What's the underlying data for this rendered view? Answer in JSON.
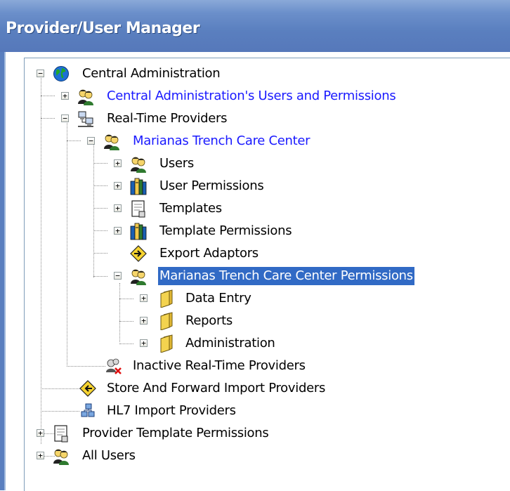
{
  "window": {
    "title": "Provider/User Manager"
  },
  "tree": {
    "root": {
      "label": "Central Administration"
    },
    "nodes": [
      {
        "label": "Central Administration's Users and Permissions"
      },
      {
        "label": "Real-Time Providers"
      },
      {
        "label": "Marianas Trench Care Center"
      },
      {
        "label": "Users"
      },
      {
        "label": "User Permissions"
      },
      {
        "label": "Templates"
      },
      {
        "label": "Template Permissions"
      },
      {
        "label": "Export Adaptors"
      },
      {
        "label": "Marianas Trench Care Center Permissions"
      },
      {
        "label": "Data Entry"
      },
      {
        "label": "Reports"
      },
      {
        "label": "Administration"
      },
      {
        "label": "Inactive Real-Time Providers"
      },
      {
        "label": "Store And Forward Import Providers"
      },
      {
        "label": "HL7 Import Providers"
      },
      {
        "label": "Provider Template Permissions"
      },
      {
        "label": "All Users"
      }
    ],
    "expander": {
      "expanded": "−",
      "collapsed": "+"
    },
    "selected_node": "Marianas Trench Care Center Permissions"
  },
  "colors": {
    "title_bar": "#5a7fbf",
    "link": "#1a1aff",
    "selection": "#316ac5"
  },
  "icons": {
    "globe": "globe-icon",
    "people": "users-icon",
    "network": "network-icon",
    "books": "books-icon",
    "document": "document-icon",
    "arrow": "arrow-diamond-icon",
    "folder": "folder-icon",
    "inactive": "inactive-users-icon",
    "hl7": "hl7-icon"
  }
}
